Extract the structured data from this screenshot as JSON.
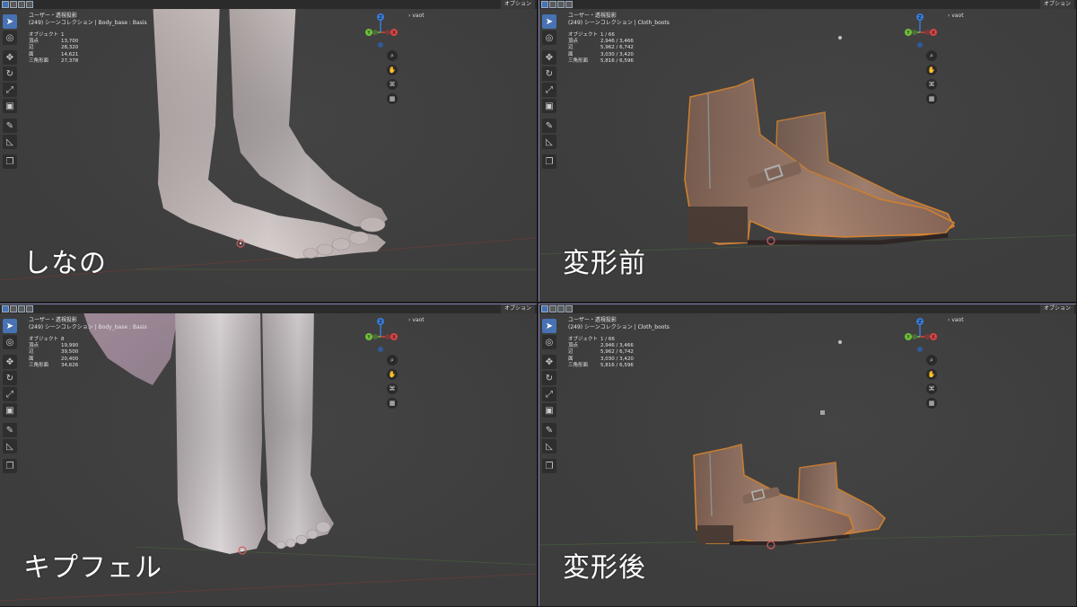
{
  "colors": {
    "viewport_bg": "#3d3d3d",
    "header_bg": "#2b2b2b",
    "active_tool": "#4772b3",
    "skin": "#d9cfcf",
    "boot": "#a07a66",
    "boot_dark": "#4a3a32",
    "selection_outline": "#e88a2a",
    "axis_x": "#d64545",
    "axis_y": "#6fbf3a",
    "axis_z": "#3a7bd5"
  },
  "common": {
    "options_label": "オプション",
    "collection_label": "vaot",
    "view_label": "ユーザー・透視投影"
  },
  "panels": [
    {
      "id": "top-left",
      "scene_path": "(249) シーンコレクション | Body_base : Basis",
      "stats": [
        {
          "label": "オブジェクト",
          "value": "1"
        },
        {
          "label": "頂点",
          "value": "13,700"
        },
        {
          "label": "辺",
          "value": "28,320"
        },
        {
          "label": "面",
          "value": "14,621"
        },
        {
          "label": "三角形面",
          "value": "27,378"
        }
      ],
      "caption": "しなの"
    },
    {
      "id": "top-right",
      "scene_path": "(249) シーンコレクション | Cloth_boots",
      "stats": [
        {
          "label": "オブジェクト",
          "value": "1 / 66"
        },
        {
          "label": "頂点",
          "value": "2,946 / 3,466"
        },
        {
          "label": "辺",
          "value": "5,962 / 6,742"
        },
        {
          "label": "面",
          "value": "3,030 / 3,420"
        },
        {
          "label": "三角形面",
          "value": "5,816 / 6,596"
        }
      ],
      "caption": "変形前"
    },
    {
      "id": "bottom-left",
      "scene_path": "(249) シーンコレクション | Body_base : Basis",
      "stats": [
        {
          "label": "オブジェクト",
          "value": "8"
        },
        {
          "label": "頂点",
          "value": "19,990"
        },
        {
          "label": "辺",
          "value": "39,500"
        },
        {
          "label": "面",
          "value": "20,400"
        },
        {
          "label": "三角形面",
          "value": "34,626"
        }
      ],
      "caption": "キプフェル"
    },
    {
      "id": "bottom-right",
      "scene_path": "(249) シーンコレクション | Cloth_boots",
      "stats": [
        {
          "label": "オブジェクト",
          "value": "1 / 66"
        },
        {
          "label": "頂点",
          "value": "2,946 / 3,466"
        },
        {
          "label": "辺",
          "value": "5,962 / 6,742"
        },
        {
          "label": "面",
          "value": "3,030 / 3,420"
        },
        {
          "label": "三角形面",
          "value": "5,816 / 6,596"
        }
      ],
      "caption": "変形後"
    }
  ],
  "tools": [
    "select-tool-icon",
    "cursor-tool-icon",
    "move-tool-icon",
    "rotate-tool-icon",
    "scale-tool-icon",
    "transform-tool-icon",
    "annotate-tool-icon",
    "measure-tool-icon",
    "add-cube-tool-icon"
  ],
  "gizmo_labels": {
    "x": "X",
    "y": "Y",
    "z": "Z"
  }
}
